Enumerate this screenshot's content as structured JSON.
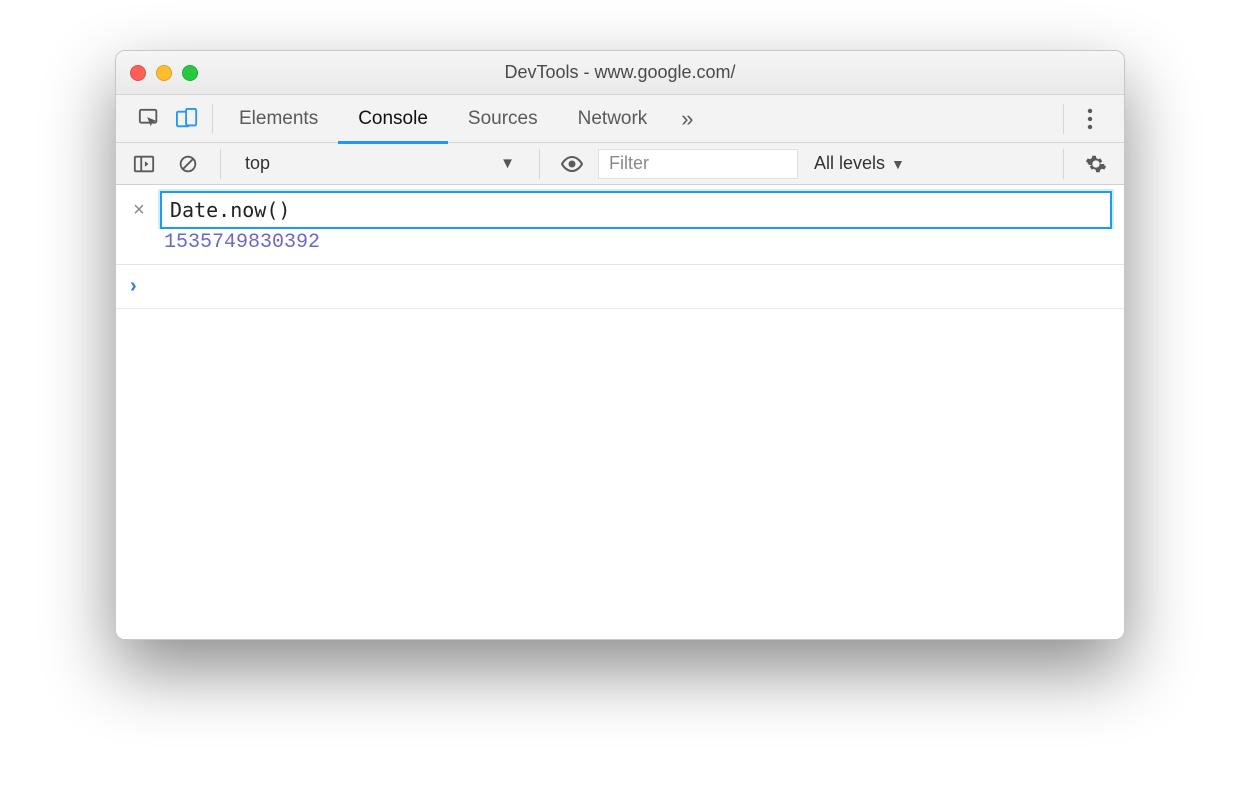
{
  "window": {
    "title": "DevTools - www.google.com/"
  },
  "tabs": {
    "items": [
      "Elements",
      "Console",
      "Sources",
      "Network"
    ],
    "active": "Console",
    "overflow_glyph": "»"
  },
  "console_toolbar": {
    "context": "top",
    "filter_placeholder": "Filter",
    "filter_value": "",
    "levels_label": "All levels"
  },
  "console": {
    "eager_expression": "Date.now()",
    "eager_result": "1535749830392",
    "prompt_marker": "›",
    "clear_marker": "×"
  },
  "colors": {
    "accent": "#2196f3",
    "result": "#6a69c7"
  }
}
